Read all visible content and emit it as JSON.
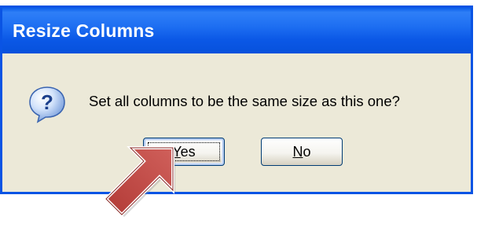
{
  "dialog": {
    "title": "Resize Columns",
    "message": "Set all columns to be the same size as this one?",
    "icon": "question-icon",
    "buttons": {
      "yes": {
        "mnemonic": "Y",
        "rest": "es"
      },
      "no": {
        "mnemonic": "N",
        "rest": "o"
      }
    }
  },
  "annotation": {
    "icon": "pointer-arrow-icon",
    "color": "#c0504d"
  },
  "colors": {
    "title_bar": "#0b58e6",
    "client_background": "#ece9d8",
    "button_border": "#003c74"
  }
}
